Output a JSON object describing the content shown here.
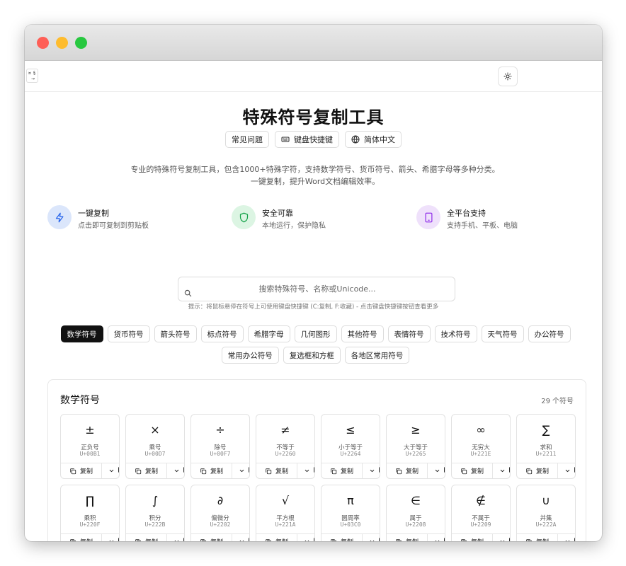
{
  "header": {
    "logo_glyphs": [
      "¤",
      "§",
      "→"
    ],
    "title": "特殊符号复制工具",
    "buttons": [
      {
        "label": "常见问题",
        "icon": ""
      },
      {
        "label": "键盘快捷键",
        "icon": "keyboard-icon"
      },
      {
        "label": "简体中文",
        "icon": "globe-icon"
      }
    ],
    "theme_icon": "sun-icon"
  },
  "description": "专业的特殊符号复制工具，包含1000+特殊字符，支持数学符号、货币符号、箭头、希腊字母等多种分类。一键复制，提升Word文档编辑效率。",
  "features": [
    {
      "title": "一键复制",
      "subtitle": "点击即可复制到剪贴板",
      "icon": "lightning-icon",
      "color": "#2563eb",
      "bg": "#dbe6fb"
    },
    {
      "title": "安全可靠",
      "subtitle": "本地运行，保护隐私",
      "icon": "shield-icon",
      "color": "#16a34a",
      "bg": "#dcf5e3"
    },
    {
      "title": "全平台支持",
      "subtitle": "支持手机、平板、电脑",
      "icon": "tablet-icon",
      "color": "#9333ea",
      "bg": "#efe1fb"
    }
  ],
  "search": {
    "placeholder": "搜索特殊符号、名称或Unicode...",
    "value": "",
    "hint": "提示：将鼠标悬停在符号上可使用键盘快捷键 (C:复制, F:收藏) - 点击键盘快捷键按钮查看更多"
  },
  "categories": [
    {
      "label": "数学符号",
      "active": true
    },
    {
      "label": "货币符号",
      "active": false
    },
    {
      "label": "箭头符号",
      "active": false
    },
    {
      "label": "标点符号",
      "active": false
    },
    {
      "label": "希腊字母",
      "active": false
    },
    {
      "label": "几何图形",
      "active": false
    },
    {
      "label": "其他符号",
      "active": false
    },
    {
      "label": "表情符号",
      "active": false
    },
    {
      "label": "技术符号",
      "active": false
    },
    {
      "label": "天气符号",
      "active": false
    },
    {
      "label": "办公符号",
      "active": false
    },
    {
      "label": "常用办公符号",
      "active": false
    },
    {
      "label": "复选框和方框",
      "active": false
    },
    {
      "label": "各地区常用符号",
      "active": false
    }
  ],
  "panel": {
    "title": "数学符号",
    "count": "29",
    "count_label": "个符号",
    "copy_label": "复制",
    "symbols": [
      {
        "symbol": "±",
        "name": "正负号",
        "code": "U+00B1"
      },
      {
        "symbol": "×",
        "name": "乘号",
        "code": "U+00D7"
      },
      {
        "symbol": "÷",
        "name": "除号",
        "code": "U+00F7"
      },
      {
        "symbol": "≠",
        "name": "不等于",
        "code": "U+2260"
      },
      {
        "symbol": "≤",
        "name": "小于等于",
        "code": "U+2264"
      },
      {
        "symbol": "≥",
        "name": "大于等于",
        "code": "U+2265"
      },
      {
        "symbol": "∞",
        "name": "无穷大",
        "code": "U+221E"
      },
      {
        "symbol": "∑",
        "name": "求和",
        "code": "U+2211"
      },
      {
        "symbol": "∏",
        "name": "乘积",
        "code": "U+220F"
      },
      {
        "symbol": "∫",
        "name": "积分",
        "code": "U+222B"
      },
      {
        "symbol": "∂",
        "name": "偏微分",
        "code": "U+2202"
      },
      {
        "symbol": "√",
        "name": "平方根",
        "code": "U+221A"
      },
      {
        "symbol": "π",
        "name": "圆周率",
        "code": "U+03C0"
      },
      {
        "symbol": "∈",
        "name": "属于",
        "code": "U+2208"
      },
      {
        "symbol": "∉",
        "name": "不属于",
        "code": "U+2209"
      },
      {
        "symbol": "∪",
        "name": "并集",
        "code": "U+222A"
      }
    ],
    "partial_row_count": 8
  },
  "colors": {
    "accent": "#111111",
    "border": "#e2e2e2"
  }
}
